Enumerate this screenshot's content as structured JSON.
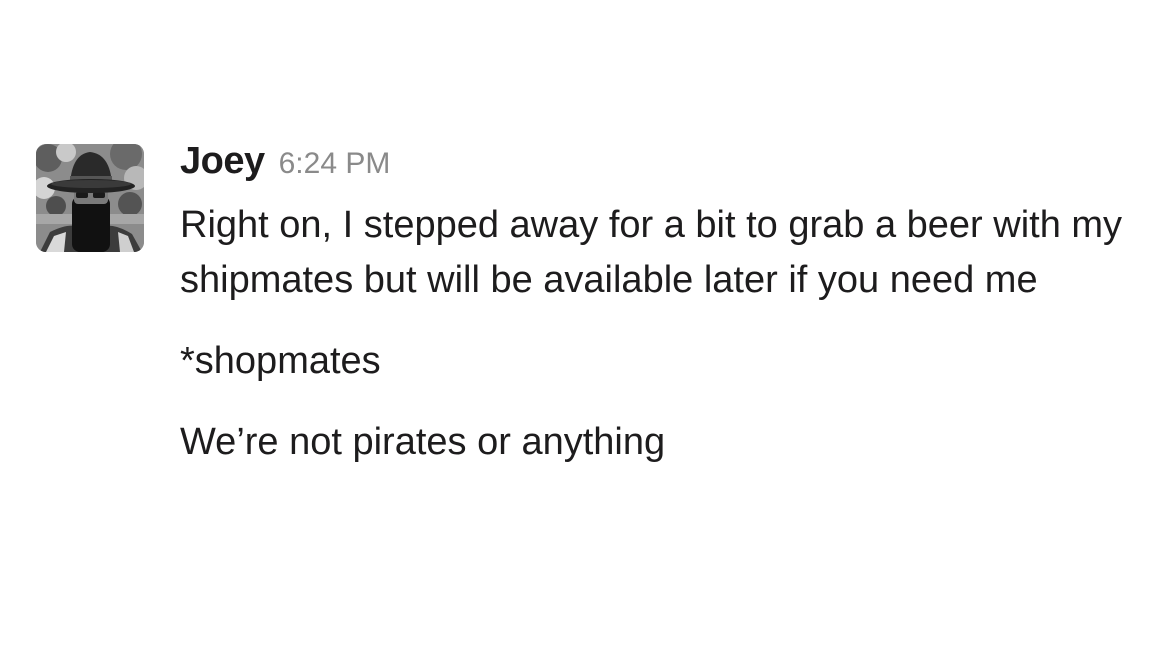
{
  "message": {
    "avatar_icon": "user-avatar",
    "sender": "Joey",
    "timestamp": "6:24 PM",
    "paragraphs": [
      "Right on, I stepped away for a bit to grab a beer with my shipmates but will be available later if you need me",
      "*shopmates",
      "We’re not pirates or anything"
    ]
  }
}
